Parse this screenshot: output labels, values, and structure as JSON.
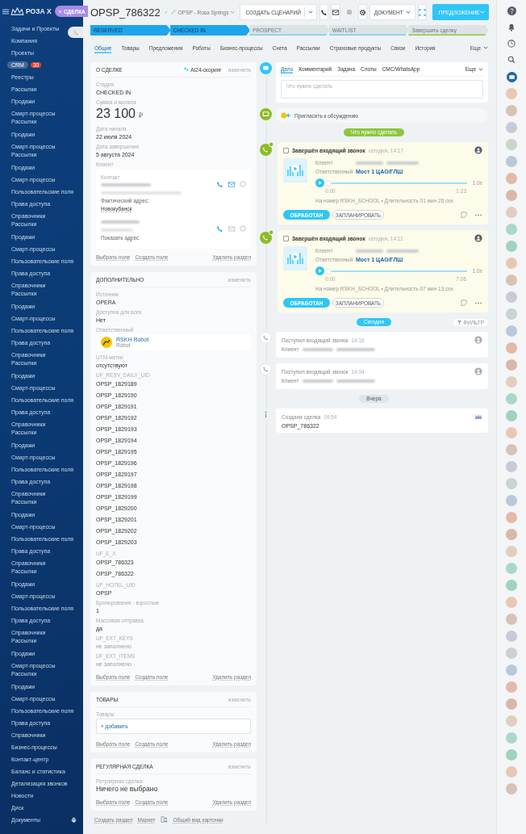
{
  "sidebar": {
    "logo": "РОЗА Х",
    "entity_tag": "СДЕЛКА",
    "items": [
      {
        "label": "Задачи и Проекты",
        "selected": false,
        "joined": false
      },
      {
        "label": "Компания",
        "selected": false,
        "joined": false
      },
      {
        "label": "Проекты",
        "selected": false,
        "joined": false
      },
      {
        "label": "CRM",
        "selected": true,
        "joined": false,
        "badge": "30"
      },
      {
        "label": "Реестры",
        "selected": false,
        "joined": false
      },
      {
        "label": "Рассылки",
        "selected": false,
        "joined": false
      },
      {
        "label": "Продажи",
        "selected": false,
        "joined": false
      },
      {
        "label": "Смарт-процессы",
        "selected": false,
        "joined": false
      },
      {
        "label": "Рассылки",
        "selected": false,
        "joined": true
      },
      {
        "label": "Продажи",
        "selected": false,
        "joined": false
      },
      {
        "label": "Смарт-процессы",
        "selected": false,
        "joined": false
      },
      {
        "label": "Рассылки",
        "selected": false,
        "joined": true
      },
      {
        "label": "Продажи",
        "selected": false,
        "joined": false
      },
      {
        "label": "Смарт-процессы",
        "selected": false,
        "joined": false
      },
      {
        "label": "Пользовательские поля",
        "selected": false,
        "joined": false
      },
      {
        "label": "Права доступа",
        "selected": false,
        "joined": false
      },
      {
        "label": "Справочники",
        "selected": false,
        "joined": false
      },
      {
        "label": "Рассылки",
        "selected": false,
        "joined": true
      },
      {
        "label": "Продажи",
        "selected": false,
        "joined": false
      },
      {
        "label": "Смарт-процессы",
        "selected": false,
        "joined": false
      },
      {
        "label": "Пользовательские поля",
        "selected": false,
        "joined": false
      },
      {
        "label": "Права доступа",
        "selected": false,
        "joined": false
      },
      {
        "label": "Справочники",
        "selected": false,
        "joined": false
      },
      {
        "label": "Рассылки",
        "selected": false,
        "joined": true
      },
      {
        "label": "Продажи",
        "selected": false,
        "joined": false
      },
      {
        "label": "Смарт-процессы",
        "selected": false,
        "joined": false
      },
      {
        "label": "Пользовательские поля",
        "selected": false,
        "joined": false
      },
      {
        "label": "Права доступа",
        "selected": false,
        "joined": false
      },
      {
        "label": "Справочники",
        "selected": false,
        "joined": false
      },
      {
        "label": "Рассылки",
        "selected": false,
        "joined": true
      },
      {
        "label": "Продажи",
        "selected": false,
        "joined": false
      },
      {
        "label": "Смарт-процессы",
        "selected": false,
        "joined": false
      },
      {
        "label": "Пользовательские поля",
        "selected": false,
        "joined": false
      },
      {
        "label": "Права доступа",
        "selected": false,
        "joined": false
      },
      {
        "label": "Справочники",
        "selected": false,
        "joined": false
      },
      {
        "label": "Рассылки",
        "selected": false,
        "joined": true
      },
      {
        "label": "Продажи",
        "selected": false,
        "joined": false
      },
      {
        "label": "Смарт-процессы",
        "selected": false,
        "joined": false
      },
      {
        "label": "Пользовательские поля",
        "selected": false,
        "joined": false
      },
      {
        "label": "Права доступа",
        "selected": false,
        "joined": false
      },
      {
        "label": "Справочники",
        "selected": false,
        "joined": false
      },
      {
        "label": "Рассылки",
        "selected": false,
        "joined": true
      },
      {
        "label": "Продажи",
        "selected": false,
        "joined": false
      },
      {
        "label": "Смарт-процессы",
        "selected": false,
        "joined": false
      },
      {
        "label": "Пользовательские поля",
        "selected": false,
        "joined": false
      },
      {
        "label": "Права доступа",
        "selected": false,
        "joined": false
      },
      {
        "label": "Справочники",
        "selected": false,
        "joined": false
      },
      {
        "label": "Рассылки",
        "selected": false,
        "joined": true
      },
      {
        "label": "Продажи",
        "selected": false,
        "joined": false
      },
      {
        "label": "Смарт-процессы",
        "selected": false,
        "joined": false
      },
      {
        "label": "Пользовательские поля",
        "selected": false,
        "joined": false
      },
      {
        "label": "Права доступа",
        "selected": false,
        "joined": false
      },
      {
        "label": "Справочники",
        "selected": false,
        "joined": false
      },
      {
        "label": "Рассылки",
        "selected": false,
        "joined": true
      },
      {
        "label": "Продажи",
        "selected": false,
        "joined": false
      },
      {
        "label": "Смарт-процессы",
        "selected": false,
        "joined": false
      },
      {
        "label": "Рассылки",
        "selected": false,
        "joined": true
      },
      {
        "label": "Продажи",
        "selected": false,
        "joined": false
      },
      {
        "label": "Смарт-процессы",
        "selected": false,
        "joined": false
      },
      {
        "label": "Пользовательские поля",
        "selected": false,
        "joined": false
      },
      {
        "label": "Права доступа",
        "selected": false,
        "joined": false
      },
      {
        "label": "Справочники",
        "selected": false,
        "joined": false
      },
      {
        "label": "Бизнес-процессы",
        "selected": false,
        "joined": false
      },
      {
        "label": "Контакт-центр",
        "selected": false,
        "joined": false
      },
      {
        "label": "Баланс и статистика",
        "selected": false,
        "joined": false
      },
      {
        "label": "Детализация звонков",
        "selected": false,
        "joined": false
      },
      {
        "label": "Новости",
        "selected": false,
        "joined": false
      },
      {
        "label": "Диск",
        "selected": false,
        "joined": false
      },
      {
        "label": "Документы",
        "selected": false,
        "joined": false
      }
    ]
  },
  "header": {
    "title": "OPSP_786322",
    "category": "OPSP - Rosa Springs",
    "scenario_button": "СОЗДАТЬ СЦЕНАРИЙ",
    "document_button": "ДОКУМЕНТ",
    "primary_button": "ПРЕДЛОЖЕНИЕ"
  },
  "stages": [
    {
      "label": "RESERVED",
      "passed": true,
      "kind": "stage"
    },
    {
      "label": "CHECKED IN",
      "passed": true,
      "kind": "stage"
    },
    {
      "label": "PROSPECT",
      "passed": false,
      "kind": "stage"
    },
    {
      "label": "WAITLIST",
      "passed": false,
      "kind": "stage"
    },
    {
      "label": "Завершить сделку",
      "passed": false,
      "kind": "final"
    }
  ],
  "tabs": [
    {
      "label": "Общие",
      "selected": true
    },
    {
      "label": "Товары",
      "selected": false
    },
    {
      "label": "Предложения",
      "selected": false
    },
    {
      "label": "Роботы",
      "selected": false
    },
    {
      "label": "Бизнес-процессы",
      "selected": false
    },
    {
      "label": "Счета",
      "selected": false
    },
    {
      "label": "Рассылки",
      "selected": false
    },
    {
      "label": "Страховые продукты",
      "selected": false
    },
    {
      "label": "Связи",
      "selected": false
    },
    {
      "label": "История",
      "selected": false
    }
  ],
  "more_tab": "Еще",
  "sections": [
    {
      "title": "О СДЕЛКЕ",
      "badge": "AI24-скоринг",
      "edit": "изменить",
      "fields": [
        {
          "kind": "text",
          "label": "Стадия",
          "value": "CHECKED IN"
        },
        {
          "kind": "money",
          "label": "Сумма и валюта",
          "value": "23 100",
          "currency": "₽"
        },
        {
          "kind": "text",
          "label": "Дата начала",
          "value": "22 июля 2024"
        },
        {
          "kind": "text",
          "label": "Дата завершения",
          "value": "5 августа 2024"
        },
        {
          "kind": "client",
          "label": "Клиент",
          "contacts": [
            {
              "label": "Контакт",
              "address_label": "Фактический адрес:",
              "address": "Новокубанск",
              "email": true
            },
            {
              "address_link": "Показать адрес",
              "email": false
            }
          ]
        }
      ],
      "links": [
        "Выбрать поле",
        "Создать поле"
      ],
      "delete": "Удалить раздел"
    },
    {
      "title": "ДОПОЛНИТЕЛЬНО",
      "edit": "изменить",
      "fields": [
        {
          "kind": "text",
          "label": "Источник",
          "value": "OPERA"
        },
        {
          "kind": "text",
          "label": "Доступна для всех",
          "value": "Нет"
        },
        {
          "kind": "person",
          "label": "Ответственный",
          "name": "RSKH Robot",
          "role": "Robot"
        },
        {
          "kind": "text",
          "label": "UTM-метки",
          "value": "отсутствуют"
        },
        {
          "kind": "list",
          "label": "UF_RESV_DAILY_UID",
          "values": [
            "OPSP_1829189",
            "OPSP_1829190",
            "OPSP_1829191",
            "OPSP_1829192",
            "OPSP_1829193",
            "OPSP_1829194",
            "OPSP_1829195",
            "OPSP_1829196",
            "OPSP_1829197",
            "OPSP_1829198",
            "OPSP_1829199",
            "OPSP_1829200",
            "OPSP_1829201",
            "OPSP_1829202",
            "OPSP_1829203"
          ]
        },
        {
          "kind": "list",
          "label": "UF_E_X",
          "values": [
            "OPSP_786323",
            "OPSP_786322"
          ]
        },
        {
          "kind": "text",
          "label": "UF_HOTEL_UID",
          "value": "OPSP"
        },
        {
          "kind": "text",
          "label": "Бронирование - взрослые",
          "value": "1"
        },
        {
          "kind": "text",
          "label": "Массовая отправка",
          "value": "да"
        },
        {
          "kind": "empty",
          "label": "UF_EXT_KEYS",
          "value": "не заполнено"
        },
        {
          "kind": "empty",
          "label": "UF_EXT_ITEMS",
          "value": "не заполнено"
        }
      ],
      "links": [
        "Выбрать поле",
        "Создать поле"
      ],
      "delete": "Удалить раздел"
    },
    {
      "title": "ТОВАРЫ",
      "edit": "изменить",
      "fields": [
        {
          "kind": "products",
          "label": "Товары",
          "add": "+ добавить"
        }
      ],
      "links": [
        "Выбрать поле",
        "Создать поле"
      ],
      "delete": "Удалить раздел"
    },
    {
      "title": "РЕГУЛЯРНАЯ СДЕЛКА",
      "edit": "изменить",
      "fields": [
        {
          "kind": "large",
          "label": "Регулярная сделка",
          "value": "Ничего не выбрано"
        }
      ],
      "links": [
        "Выбрать поле",
        "Создать поле"
      ],
      "delete": "Удалить раздел"
    }
  ],
  "footer_links": [
    "Создать раздел",
    "Маркет",
    "Общий вид карточки"
  ],
  "timeline": {
    "composer": {
      "tabs": [
        {
          "label": "Дело",
          "selected": true
        },
        {
          "label": "Комментарий",
          "selected": false
        },
        {
          "label": "Задача",
          "selected": false
        },
        {
          "label": "Слоты",
          "selected": false
        },
        {
          "label": "СМС/WhatsApp",
          "selected": false
        }
      ],
      "more": "Еще",
      "placeholder": "Что нужно сделать"
    },
    "comment": {
      "placeholder": "Пригласить к обсуждению"
    },
    "items": [
      {
        "kind": "divider",
        "color": "#8dc63f",
        "label": "Что нужно сделать"
      },
      {
        "kind": "call_done",
        "checked": false,
        "title": "Завершён входящий звонок",
        "time": "сегодня, 14:17",
        "client_label": "Клиент",
        "responsible_label": "Ответственный",
        "responsible": "Мост 1 ЦАО/ГЛШ",
        "level": 0,
        "speed": "1.0x",
        "start": "0:00",
        "end": "1:23",
        "info": "На номер RSKH_SCHOOL • Длительность 01 мин 28 сек",
        "done_button": "ОБРАБОТАН",
        "plan_button": "ЗАПЛАНИРОВАТЬ"
      },
      {
        "kind": "call_done",
        "checked": false,
        "title": "Завершён входящий звонок",
        "time": "сегодня, 14:11",
        "client_label": "Клиент",
        "responsible_label": "Ответственный",
        "responsible": "Мост 1 ЦАО/ГЛШ",
        "level": 0,
        "speed": "1.0x",
        "start": "0:00",
        "end": "7:06",
        "info": "На номер RSKH_SCHOOL • Длительность 07 мин 13 сек",
        "done_button": "ОБРАБОТАН",
        "plan_button": "ЗАПЛАНИРОВАТЬ"
      },
      {
        "kind": "divider",
        "color": "#2fc6f6",
        "label": "Сегодня",
        "filter": "ФИЛЬТР"
      },
      {
        "kind": "call_in",
        "title": "Поступил входящий звонок",
        "time": "14:16",
        "client_label": "Клиент"
      },
      {
        "kind": "call_in",
        "title": "Поступил входящий звонок",
        "time": "14:04",
        "client_label": "Клиент"
      },
      {
        "kind": "divider",
        "color": "#dfe5e8",
        "label": "Вчера"
      },
      {
        "kind": "created",
        "title": "Создана сделка",
        "time": "09:54",
        "value": "OPSP_786322"
      }
    ]
  }
}
